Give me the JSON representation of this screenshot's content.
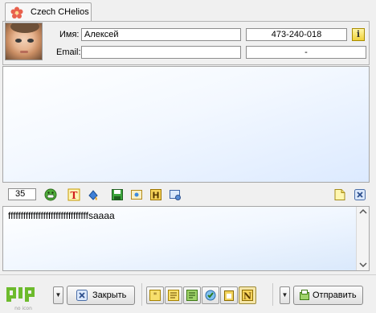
{
  "tab": {
    "label": "Czech CHelios"
  },
  "contact": {
    "name_label": "Имя:",
    "name_value": "Алексей",
    "email_label": "Email:",
    "email_value": "",
    "uin": "473-240-018",
    "status": "-"
  },
  "toolbar": {
    "font_size": "35"
  },
  "input": {
    "text": "ffffffffffffffffffffffffffffffffsaaaa"
  },
  "bottom": {
    "logo_caption": "no icon",
    "close_label": "Закрыть",
    "send_label": "Отправить"
  },
  "colors": {
    "accent": "#2f63c6",
    "history_bg": "#dceaff",
    "qip_green": "#6dbb2d"
  }
}
